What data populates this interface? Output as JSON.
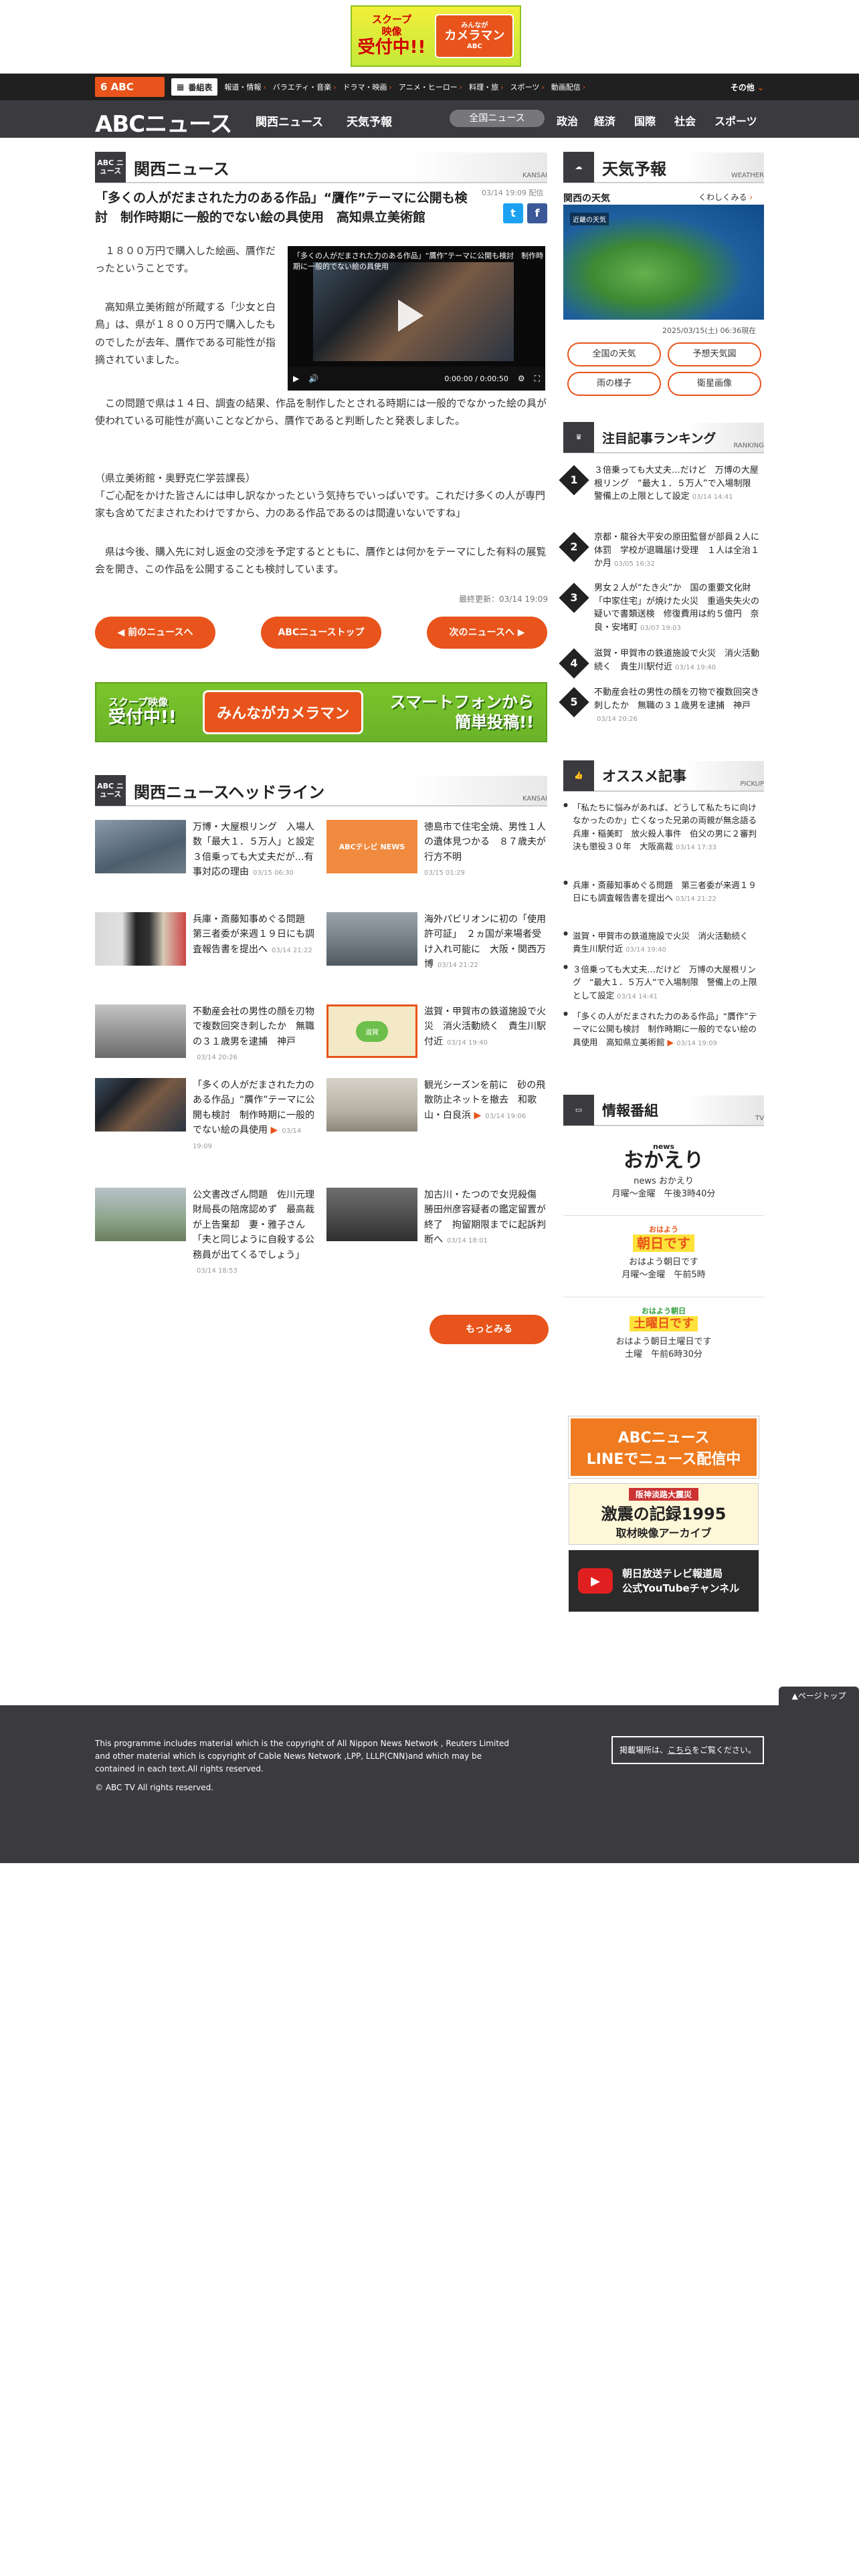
{
  "top_banner": {
    "line1": "スクープ",
    "line2": "映像",
    "line3": "受付中!!",
    "badge_small": "みんなが",
    "badge_big": "カメラマン",
    "badge_sub": "ABC"
  },
  "nav1": {
    "logo": "6 ABC",
    "bangumi": "番組表",
    "items": [
      "報道・情報",
      "バラエティ・音楽",
      "ドラマ・映画",
      "アニメ・ヒーロー",
      "料理・旅",
      "スポーツ",
      "動画配信"
    ],
    "other": "その他"
  },
  "nav2": {
    "logo": "ABCニュース",
    "links": [
      "関西ニュース",
      "天気予報"
    ],
    "pill": "全国ニュース",
    "cats": [
      "政治",
      "経済",
      "国際",
      "社会",
      "スポーツ"
    ]
  },
  "kansai_section": {
    "icon": "ABC ニュース",
    "title": "関西ニュース",
    "tag": "KANSAI"
  },
  "article": {
    "title": "「多くの人がだまされた力のある作品」“贋作”テーマに公開も検討　制作時期に一般的でない絵の具使用　高知県立美術館",
    "date": "03/14 19:09 配信",
    "share_tw": "t",
    "share_fb": "f",
    "p1": "　１８００万円で購入した絵画、贋作だったということです。",
    "p2": "　高知県立美術館が所蔵する「少女と白鳥」は、県が１８００万円で購入したものでしたが去年、贋作である可能性が指摘されていました。",
    "p3": "　この問題で県は１４日、調査の結果、作品を制作したとされる時期には一般的でなかった絵の具が使われている可能性が高いことなどから、贋作であると判断したと発表しました。",
    "p4a": "（県立美術館・奥野克仁学芸課長）",
    "p4b": "「ご心配をかけた皆さんには申し訳なかったという気持ちでいっぱいです。これだけ多くの人が専門家も含めてだまされたわけですから、力のある作品であるのは間違いないですね」",
    "p5": "　県は今後、購入先に対し返金の交渉を予定するとともに、贋作とは何かをテーマにした有料の展覧会を開き、この作品を公開することも検討しています。",
    "video_title": "「多くの人がだまされた力のある作品」“贋作”テーマに公開も検討　制作時期に一般的でない絵の具使用",
    "video_time": "0:00:00 / 0:00:50",
    "updated": "最終更新：03/14 19:09",
    "btn_prev": "前のニュースへ",
    "btn_top": "ABCニューストップ",
    "btn_next": "次のニュースへ"
  },
  "mid_banner": {
    "l1": "スクープ映像",
    "l2": "受付中!!",
    "c1": "みんなが",
    "c2": "カメラマン",
    "r1": "スマートフォンから",
    "r2": "簡単投稿!!"
  },
  "headline_section": {
    "icon": "ABC ニュース",
    "title": "関西ニュースヘッドライン",
    "tag": "KANSAI"
  },
  "headlines": [
    {
      "title": "万博・大屋根リング　入場人数「最大１．５万人」と設定　３倍乗っても大丈夫だが…有事対応の理由",
      "date": "03/15 06:30"
    },
    {
      "title": "徳島市で住宅全焼、男性１人の遺体見つかる　８７歳夫が行方不明",
      "date": "03/15 01:29",
      "thumb_label": "ABCテレビ NEWS"
    },
    {
      "title": "兵庫・斎藤知事めぐる問題　第三者委が来週１９日にも調査報告書を提出へ",
      "date": "03/14 21:22"
    },
    {
      "title": "海外パビリオンに初の「使用許可証」　２ヵ国が来場者受け入れ可能に　大阪・関西万博",
      "date": "03/14 21:22"
    },
    {
      "title": "不動産会社の男性の顔を刃物で複数回突き刺したか　無職の３１歳男を逮捕　神戸",
      "date": "03/14 20:26"
    },
    {
      "title": "滋賀・甲賀市の鉄道施設で火災　消火活動続く　貴生川駅付近",
      "date": "03/14 19:40",
      "thumb_label": "滋賀"
    },
    {
      "title": "「多くの人がだまされた力のある作品」“贋作”テーマに公開も検討　制作時期に一般的でない絵の具使用",
      "date": "03/14 19:09"
    },
    {
      "title": "観光シーズンを前に　砂の飛散防止ネットを撤去　和歌山・白良浜",
      "date": "03/14 19:06"
    },
    {
      "title": "公文書改ざん問題　佐川元理財局長の陪席認めず　最高裁が上告棄却　妻・雅子さん「夫と同じように自殺する公務員が出てくるでしょう」",
      "date": "03/14 18:53"
    },
    {
      "title": "加古川・たつので女児殺傷　勝田州彦容疑者の鑑定留置が終了　拘留期限までに起訴判断へ",
      "date": "03/14 18:01"
    }
  ],
  "more": "もっとみる",
  "weather": {
    "title": "天気予報",
    "tag": "WEATHER",
    "sub": "関西の天気",
    "link": "くわしくみる",
    "map_label": "近畿の天気",
    "time": "2025/03/15(土) 06:36現在",
    "btns": [
      "全国の天気",
      "予想天気図",
      "雨の様子",
      "衛星画像"
    ]
  },
  "ranking": {
    "title": "注目記事ランキング",
    "tag": "RANKING",
    "items": [
      {
        "n": "1",
        "title": "３倍乗っても大丈夫…だけど　万博の大屋根リング　“最大１．５万人”で入場制限　警備上の上限として設定",
        "date": "03/14 14:41"
      },
      {
        "n": "2",
        "title": "京都・龍谷大平安の原田監督が部員２人に体罰　学校が退職届け受理　１人は全治１か月",
        "date": "03/05 16:32"
      },
      {
        "n": "3",
        "title": "男女２人が“たき火”か　国の重要文化財「中家住宅」が焼けた火災　重過失失火の疑いで書類送検　修復費用は約５億円　奈良・安堵町",
        "date": "03/07 19:03"
      },
      {
        "n": "4",
        "title": "滋賀・甲賀市の鉄道施設で火災　消火活動続く　貴生川駅付近",
        "date": "03/14 19:40"
      },
      {
        "n": "5",
        "title": "不動産会社の男性の顔を刃物で複数回突き刺したか　無職の３１歳男を逮捕　神戸",
        "date": "03/14 20:26"
      }
    ]
  },
  "pickup": {
    "title": "オススメ記事",
    "tag": "PICKUP",
    "items": [
      {
        "title": "「私たちに悩みがあれば、どうして私たちに向けなかったのか」亡くなった兄弟の両親が無念語る　兵庫・稲美町　放火殺人事件　伯父の男に２審判決も懲役３０年　大阪高裁",
        "date": "03/14 17:33"
      },
      {
        "title": "兵庫・斎藤知事めぐる問題　第三者委が来週１９日にも調査報告書を提出へ",
        "date": "03/14 21:22"
      },
      {
        "title": "滋賀・甲賀市の鉄道施設で火災　消火活動続く　貴生川駅付近",
        "date": "03/14 19:40"
      },
      {
        "title": "３倍乗っても大丈夫…だけど　万博の大屋根リング　“最大１．５万人”で入場制限　警備上の上限として設定",
        "date": "03/14 14:41"
      },
      {
        "title": "「多くの人がだまされた力のある作品」“贋作”テーマに公開も検討　制作時期に一般的でない絵の具使用　高知県立美術館",
        "date": "03/14 19:09"
      }
    ]
  },
  "programs": {
    "title": "情報番組",
    "tag": "TV",
    "items": [
      {
        "logo_small": "news",
        "logo": "おかえり",
        "name": "news おかえり",
        "time": "月曜〜金曜　午後3時40分"
      },
      {
        "logo_small": "おはよう",
        "logo": "朝日です",
        "name": "おはよう朝日です",
        "time": "月曜〜金曜　午前5時"
      },
      {
        "logo_small": "おはよう朝日",
        "logo": "土曜日です",
        "name": "おはよう朝日土曜日です",
        "time": "土曜　午前6時30分"
      }
    ]
  },
  "side_banners": {
    "line_1": "ABCニュース",
    "line_2": "LINEでニュース配信中",
    "kiroku_top": "阪神淡路大震災",
    "kiroku_main": "激震の記録1995",
    "kiroku_sub": "取材映像アーカイブ",
    "yt_1": "朝日放送テレビ報道局",
    "yt_2": "公式YouTubeチャンネル"
  },
  "footer": {
    "text": "This programme includes material which is the copyright of All Nippon News Network , Reuters Limited and other material which is copyright of Cable News Network ,LPP, LLLP(CNN)and which may be contained in each text.All rights reserved.",
    "copy": "© ABC TV All rights reserved.",
    "btn_pre": "掲載場所は、",
    "btn_link": "こちら",
    "btn_post": "をご覧ください。",
    "pagetop": "▲ページトップ"
  },
  "colors": {
    "accent": "#e8541b",
    "dark": "#3b3a3f",
    "nav": "#202020"
  }
}
